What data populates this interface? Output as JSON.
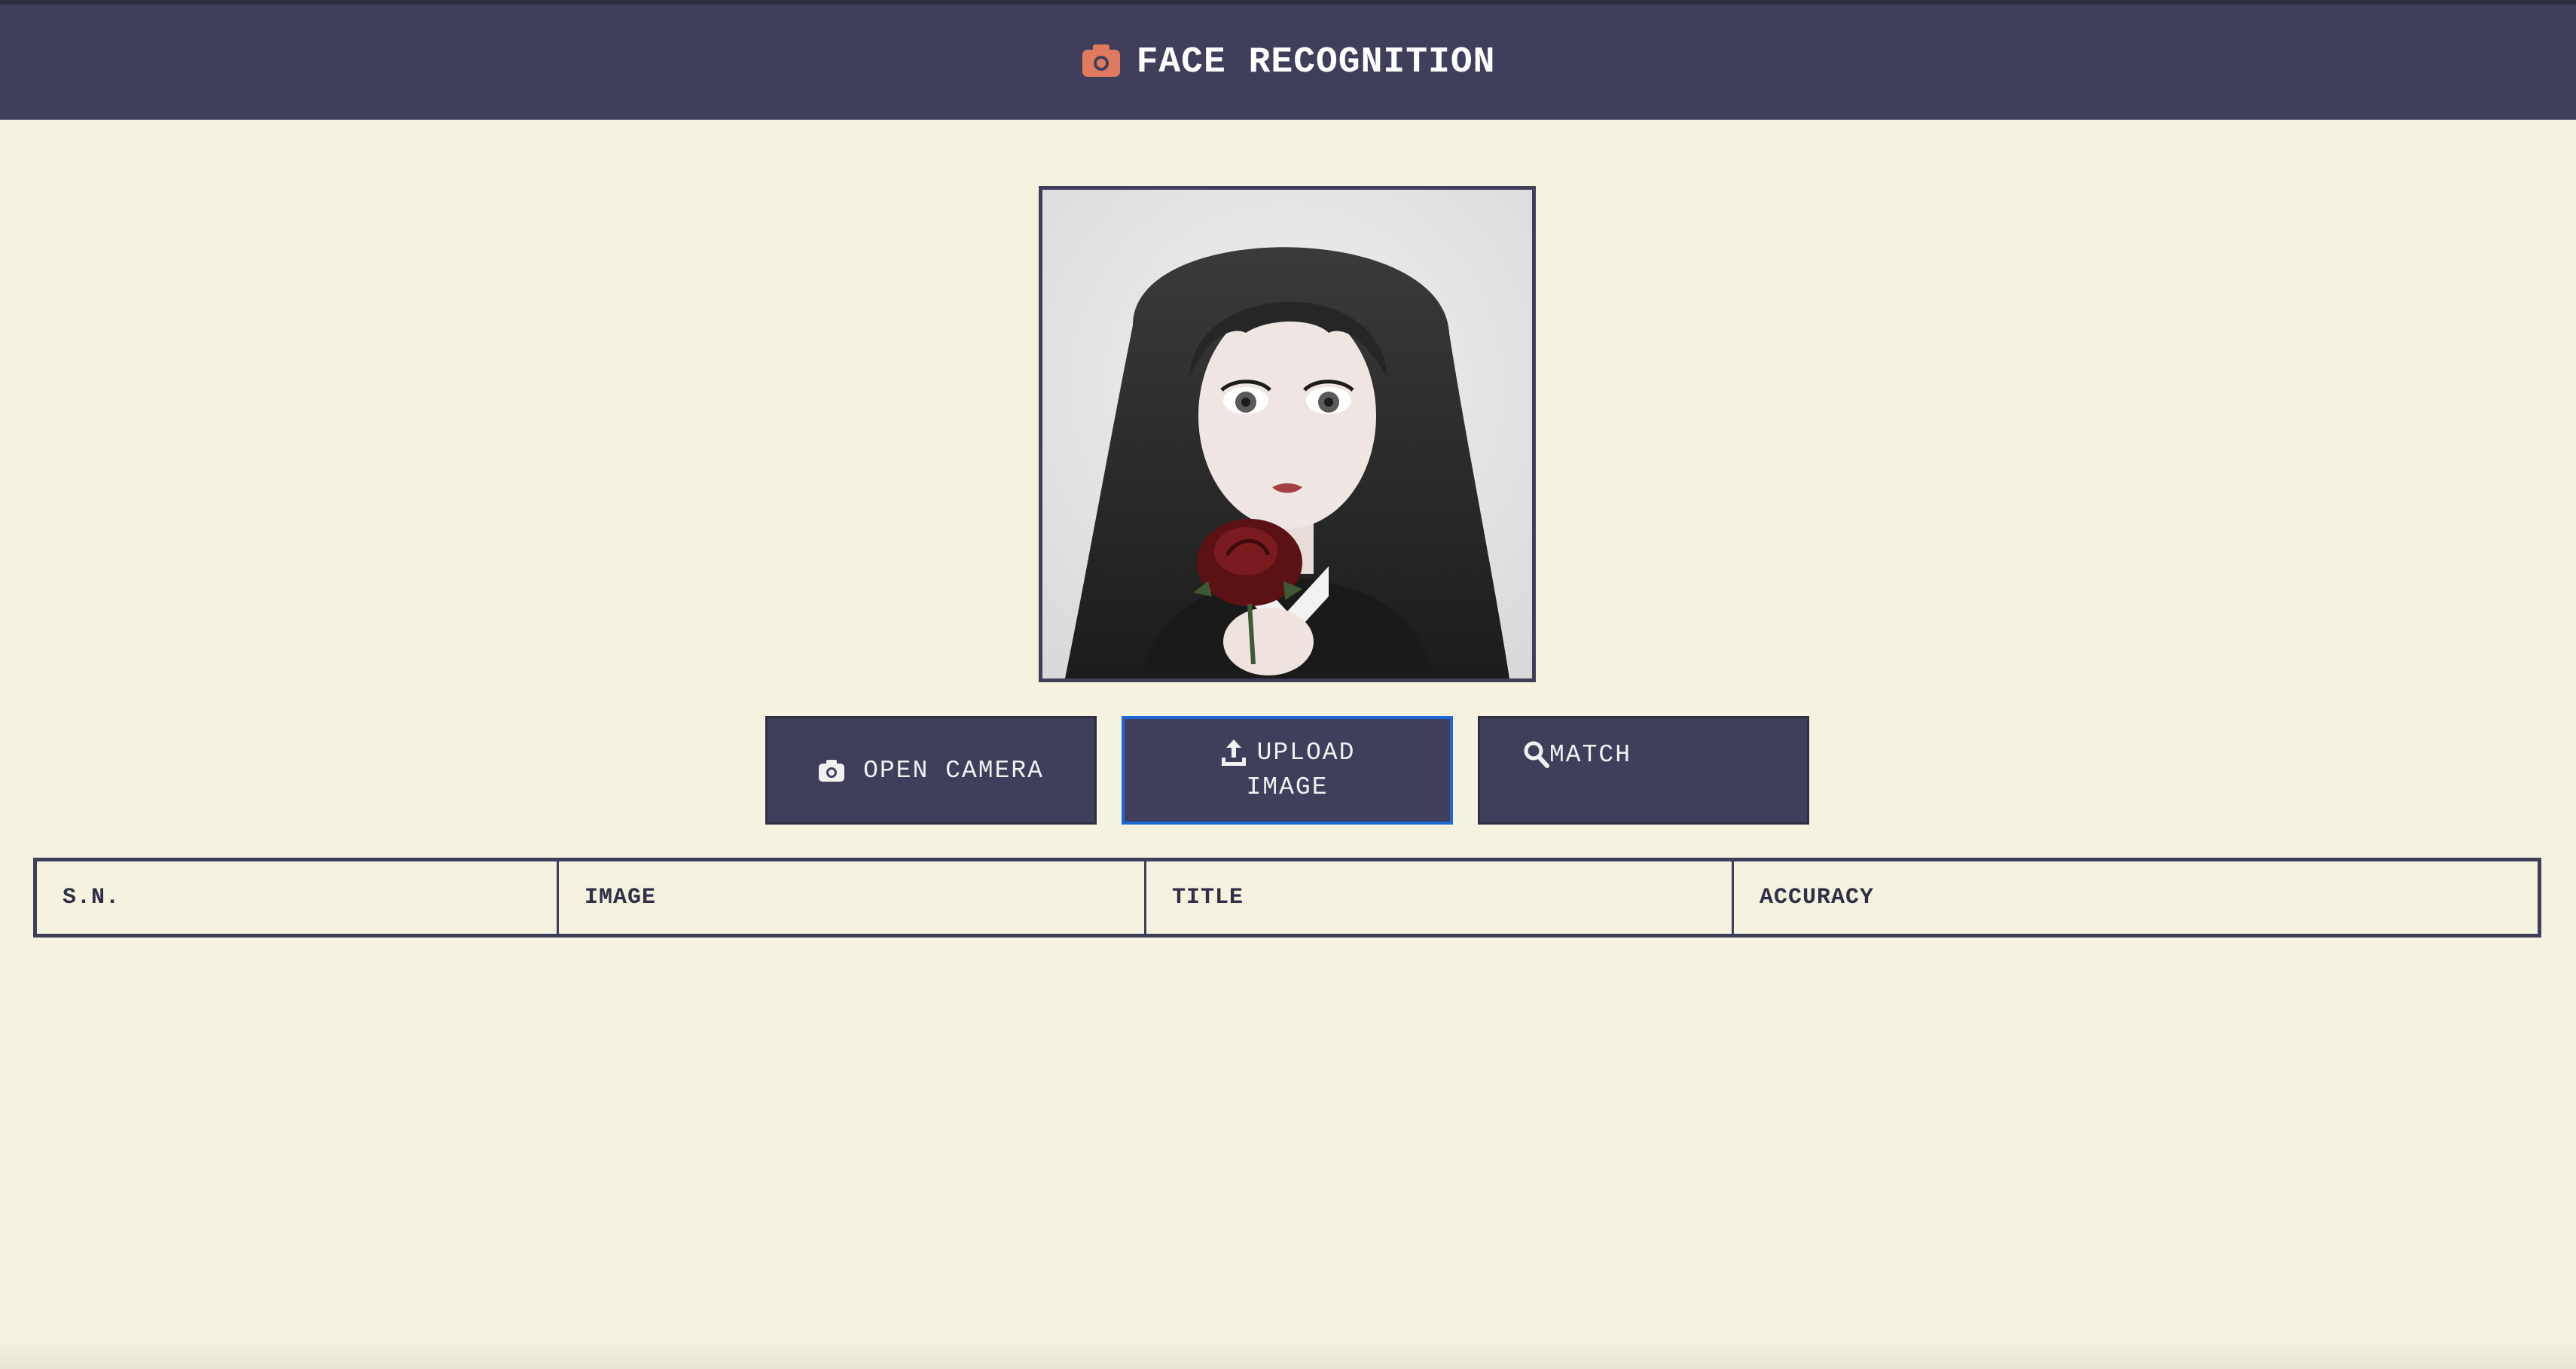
{
  "header": {
    "title": "FACE RECOGNITION",
    "icon": "camera-icon",
    "icon_color": "#e07a5f",
    "bg_color": "#3f3f5b"
  },
  "preview": {
    "description_icon": "image-preview"
  },
  "buttons": {
    "open_camera": {
      "label": "OPEN CAMERA",
      "icon": "camera-icon"
    },
    "upload_image": {
      "label_line1": "UPLOAD",
      "label_line2": "IMAGE",
      "icon": "upload-icon"
    },
    "match": {
      "label": "MATCH",
      "icon": "search-icon"
    }
  },
  "table": {
    "columns": [
      "S.N.",
      "IMAGE",
      "TITLE",
      "ACCURACY"
    ],
    "rows": []
  },
  "colors": {
    "page_bg": "#f5f2df",
    "button_bg": "#3f3f5b",
    "focus_border": "#1f67d6"
  }
}
